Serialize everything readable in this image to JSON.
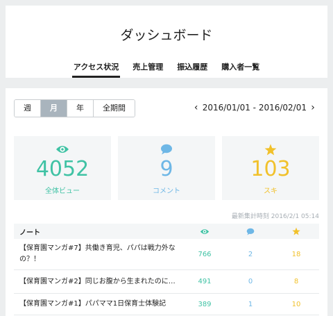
{
  "header": {
    "title": "ダッシュボード",
    "tabs": [
      {
        "label": "アクセス状況",
        "active": true
      },
      {
        "label": "売上管理",
        "active": false
      },
      {
        "label": "振込履歴",
        "active": false
      },
      {
        "label": "購入者一覧",
        "active": false
      }
    ]
  },
  "period": {
    "options": [
      "週",
      "月",
      "年",
      "全期間"
    ],
    "selected": "月"
  },
  "range": {
    "text": "2016/01/01 - 2016/02/01",
    "prev_icon": "chevron-left-icon",
    "next_icon": "chevron-right-icon"
  },
  "stats": [
    {
      "icon": "eye-icon",
      "value": "4052",
      "label": "全体ビュー",
      "color": "#3fc2a4"
    },
    {
      "icon": "comment-icon",
      "value": "9",
      "label": "コメント",
      "color": "#6eb7e6"
    },
    {
      "icon": "star-icon",
      "value": "103",
      "label": "スキ",
      "color": "#f1c12b"
    }
  ],
  "updated": "最新集計時刻 2016/2/1 05:14",
  "table": {
    "headers": {
      "note": "ノート",
      "views_icon": "eye-icon",
      "comments_icon": "comment-icon",
      "likes_icon": "star-icon"
    },
    "rows": [
      {
        "title": "【保育園マンガ#7】共働き育児、パパは戦力外なの？！",
        "views": "766",
        "comments": "2",
        "likes": "18"
      },
      {
        "title": "【保育園マンガ#2】同じお腹から生まれたのに…",
        "views": "491",
        "comments": "0",
        "likes": "8"
      },
      {
        "title": "【保育園マンガ#1】パパママ1日保育士体験記",
        "views": "389",
        "comments": "1",
        "likes": "10"
      }
    ]
  }
}
